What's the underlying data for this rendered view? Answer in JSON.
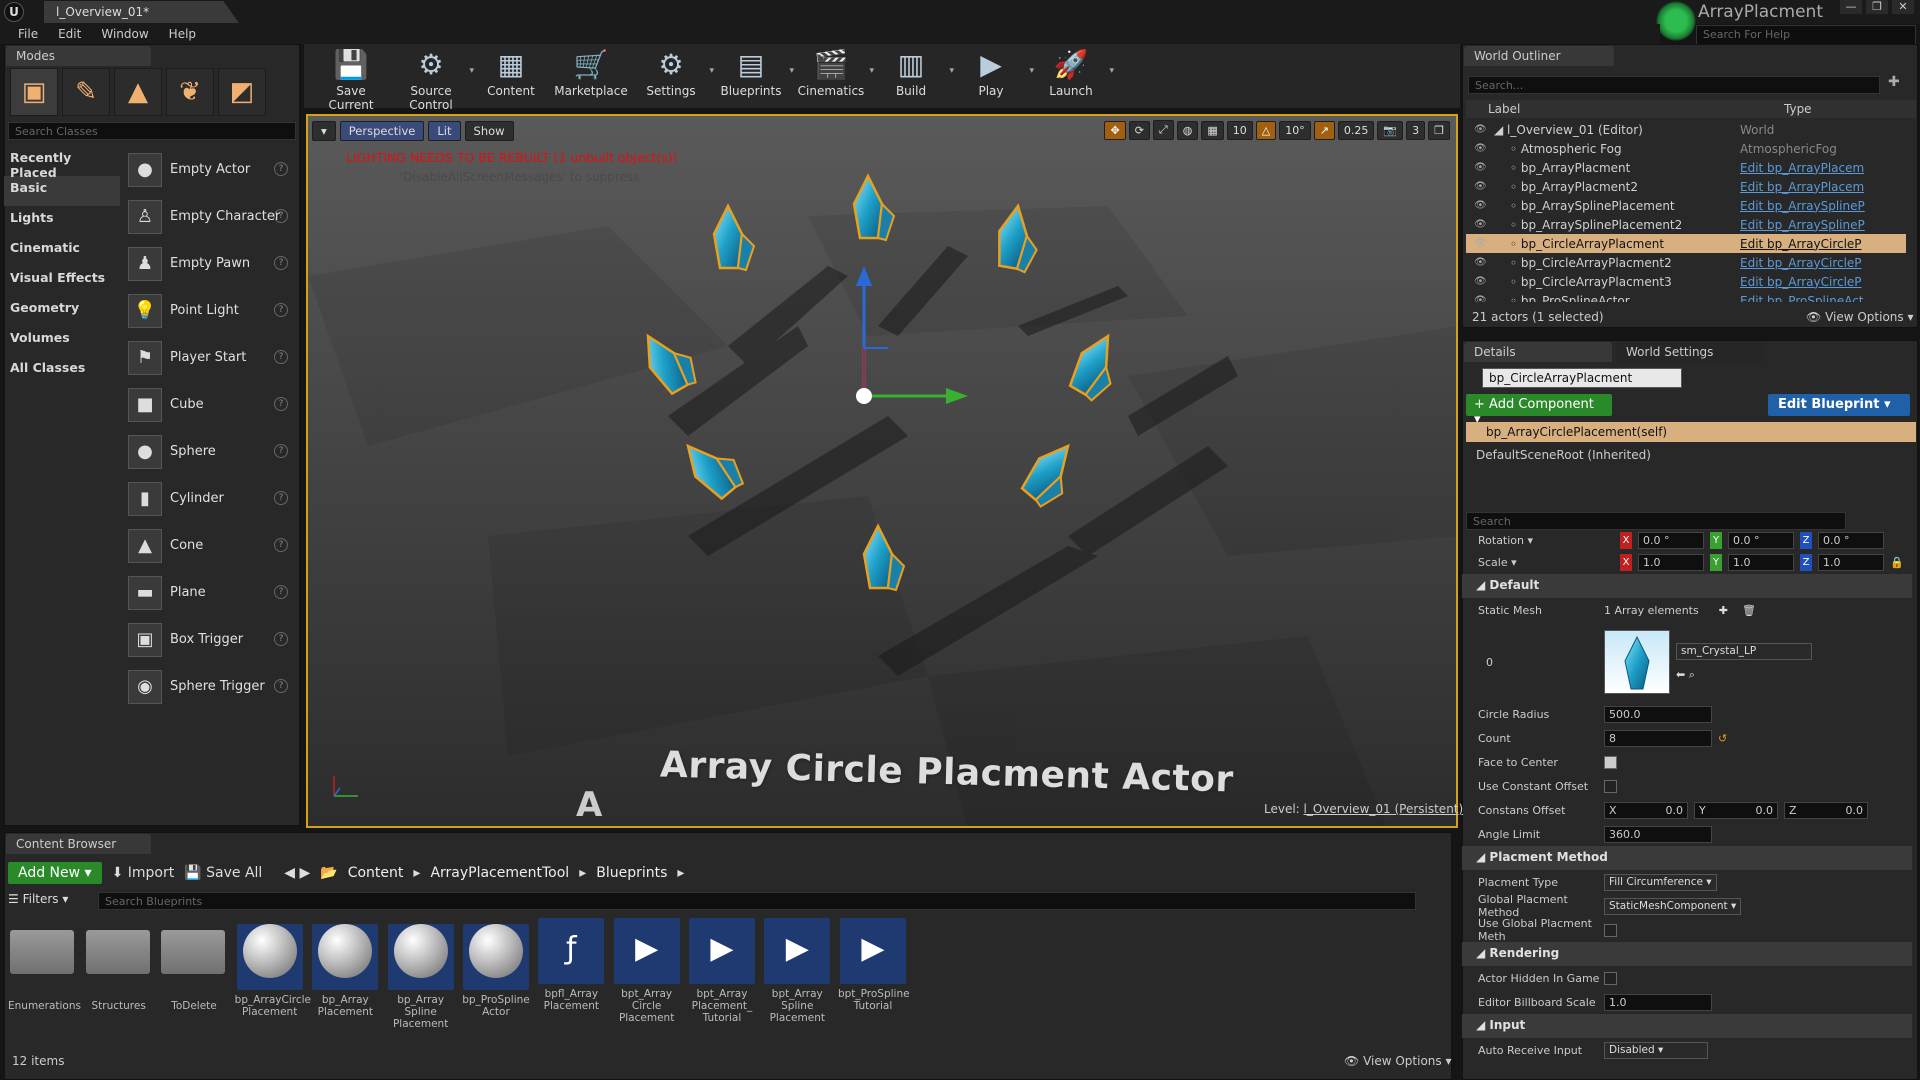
{
  "window": {
    "doc_tab": "l_Overview_01*",
    "project": "ArrayPlacment",
    "help_search": "Search For Help",
    "controls": [
      "—",
      "❐",
      "✕"
    ]
  },
  "menu": [
    "File",
    "Edit",
    "Window",
    "Help"
  ],
  "modes": {
    "tab": "Modes",
    "search_placeholder": "Search Classes",
    "categories": [
      "Recently Placed",
      "Basic",
      "Lights",
      "Cinematic",
      "Visual Effects",
      "Geometry",
      "Volumes",
      "All Classes"
    ],
    "items": [
      {
        "label": "Empty Actor",
        "icon": "●"
      },
      {
        "label": "Empty Character",
        "icon": "♙"
      },
      {
        "label": "Empty Pawn",
        "icon": "♟"
      },
      {
        "label": "Point Light",
        "icon": "💡"
      },
      {
        "label": "Player Start",
        "icon": "⚑"
      },
      {
        "label": "Cube",
        "icon": "■"
      },
      {
        "label": "Sphere",
        "icon": "●"
      },
      {
        "label": "Cylinder",
        "icon": "▮"
      },
      {
        "label": "Cone",
        "icon": "▲"
      },
      {
        "label": "Plane",
        "icon": "▬"
      },
      {
        "label": "Box Trigger",
        "icon": "▣"
      },
      {
        "label": "Sphere Trigger",
        "icon": "◉"
      }
    ]
  },
  "toolbar": [
    "Save Current",
    "Source Control",
    "Content",
    "Marketplace",
    "Settings",
    "Blueprints",
    "Cinematics",
    "Build",
    "Play",
    "Launch"
  ],
  "viewport": {
    "perspective": "Perspective",
    "lit": "Lit",
    "show": "Show",
    "right_controls": [
      "10",
      "10°",
      "0.25",
      "3"
    ],
    "warning": "LIGHTING NEEDS TO BE REBUILT (1 unbuilt object(s))",
    "warning2": "'DisableAllScreenMessages' to suppress",
    "title": "Array Circle Placment Actor",
    "level_prefix": "Level:",
    "level_name": "l_Overview_01 (Persistent)"
  },
  "outliner": {
    "tab": "World Outliner",
    "search_placeholder": "Search...",
    "col_label": "Label",
    "col_type": "Type",
    "rows": [
      {
        "label": "l_Overview_01 (Editor)",
        "type": "World"
      },
      {
        "label": "Atmospheric Fog",
        "type": "AtmosphericFog"
      },
      {
        "label": "bp_ArrayPlacment",
        "type": "Edit bp_ArrayPlacem"
      },
      {
        "label": "bp_ArrayPlacment2",
        "type": "Edit bp_ArrayPlacem"
      },
      {
        "label": "bp_ArraySplinePlacement",
        "type": "Edit bp_ArraySplineP"
      },
      {
        "label": "bp_ArraySplinePlacement2",
        "type": "Edit bp_ArraySplineP"
      },
      {
        "label": "bp_CircleArrayPlacment",
        "type": "Edit bp_ArrayCircleP"
      },
      {
        "label": "bp_CircleArrayPlacment2",
        "type": "Edit bp_ArrayCircleP"
      },
      {
        "label": "bp_CircleArrayPlacment3",
        "type": "Edit bp_ArrayCircleP"
      },
      {
        "label": "bp_ProSplineActor",
        "type": "Edit bp_ProSplineAct"
      }
    ],
    "footer": "21 actors (1 selected)",
    "view_options": "View Options"
  },
  "details": {
    "tab": "Details",
    "tab2": "World Settings",
    "name": "bp_CircleArrayPlacment",
    "add_component": "+ Add Component ▾",
    "edit_blueprint": "Edit Blueprint ▾",
    "comp_self": "bp_ArrayCirclePlacement(self)",
    "comp_root": "DefaultSceneRoot (Inherited)",
    "search_placeholder": "Search",
    "rotation_label": "Rotation ▾",
    "rotation": [
      "0.0 °",
      "0.0 °",
      "0.0 °"
    ],
    "scale_label": "Scale ▾",
    "scale": [
      "1.0",
      "1.0",
      "1.0"
    ],
    "sec_default": "Default",
    "static_mesh_label": "Static Mesh",
    "array_elements": "1 Array elements",
    "index0": "0",
    "mesh_name": "sm_Crystal_LP",
    "circle_radius_label": "Circle Radius",
    "circle_radius": "500.0",
    "count_label": "Count",
    "count": "8",
    "face_center_label": "Face to Center",
    "face_center": true,
    "use_const_label": "Use Constant Offset",
    "use_const": false,
    "const_offset_label": "Constans Offset",
    "const_offset": [
      "0.0",
      "0.0",
      "0.0"
    ],
    "angle_limit_label": "Angle Limit",
    "angle_limit": "360.0",
    "sec_method": "Placment Method",
    "placement_type_label": "Placment Type",
    "placement_type": "Fill Circumference ▾",
    "global_method_label": "Global Placment Method",
    "global_method": "StaticMeshComponent ▾",
    "use_global_label": "Use Global Placment Meth",
    "use_global": false,
    "sec_rendering": "Rendering",
    "hidden_label": "Actor Hidden In Game",
    "hidden": false,
    "billboard_label": "Editor Billboard Scale",
    "billboard": "1.0",
    "sec_input": "Input",
    "auto_input_label": "Auto Receive Input",
    "auto_input": "Disabled ▾"
  },
  "content_browser": {
    "tab": "Content Browser",
    "add_new": "Add New ▾",
    "import": "Import",
    "save_all": "Save All",
    "crumbs": [
      "Content",
      "ArrayPlacementTool",
      "Blueprints"
    ],
    "filters": "Filters ▾",
    "search_placeholder": "Search Blueprints",
    "assets": [
      {
        "kind": "folder",
        "label": "Enumerations"
      },
      {
        "kind": "folder",
        "label": "Structures"
      },
      {
        "kind": "folder",
        "label": "ToDelete"
      },
      {
        "kind": "sphere",
        "label": "bp_ArrayCircle Placement"
      },
      {
        "kind": "sphere",
        "label": "bp_Array Placement"
      },
      {
        "kind": "sphere",
        "label": "bp_Array Spline Placement"
      },
      {
        "kind": "sphere",
        "label": "bp_ProSpline Actor"
      },
      {
        "kind": "func",
        "label": "bpfl_Array Placement"
      },
      {
        "kind": "bp",
        "label": "bpt_Array Circle Placement"
      },
      {
        "kind": "bp",
        "label": "bpt_Array Placement_ Tutorial"
      },
      {
        "kind": "bp",
        "label": "bpt_Array Spline Placement"
      },
      {
        "kind": "bp",
        "label": "bpt_ProSpline Tutorial"
      }
    ],
    "count": "12 items",
    "view_options": "View Options ▾"
  }
}
